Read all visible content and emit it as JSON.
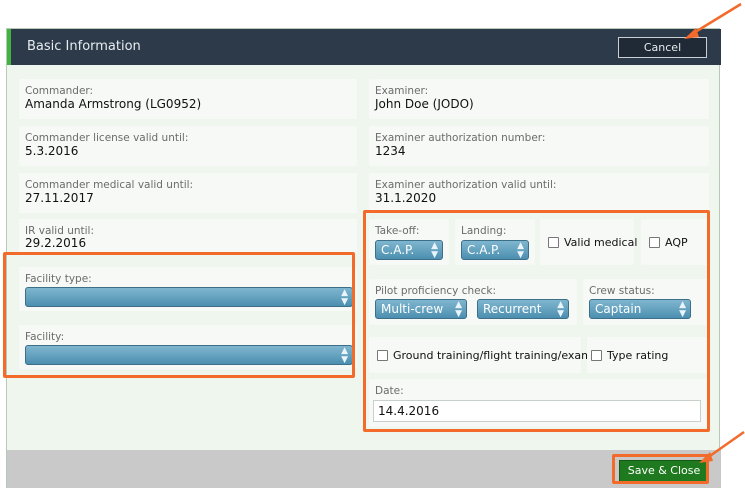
{
  "header": {
    "title": "Basic Information",
    "cancel_label": "Cancel"
  },
  "left": {
    "commander": {
      "label": "Commander:",
      "value": "Amanda Armstrong (LG0952)"
    },
    "license": {
      "label": "Commander license valid until:",
      "value": "5.3.2016"
    },
    "medical": {
      "label": "Commander medical valid until:",
      "value": "27.11.2017"
    },
    "ir": {
      "label": "IR valid until:",
      "value": "29.2.2016"
    },
    "facility_type": {
      "label": "Facility type:",
      "value": ""
    },
    "facility": {
      "label": "Facility:",
      "value": ""
    }
  },
  "right": {
    "examiner": {
      "label": "Examiner:",
      "value": "John Doe (JODO)"
    },
    "auth_number": {
      "label": "Examiner authorization number:",
      "value": "1234"
    },
    "auth_valid": {
      "label": "Examiner authorization valid until:",
      "value": "31.1.2020"
    },
    "takeoff": {
      "label": "Take-off:",
      "value": "C.A.P."
    },
    "landing": {
      "label": "Landing:",
      "value": "C.A.P."
    },
    "valid_medical": {
      "label": "Valid medical",
      "checked": false
    },
    "aqp": {
      "label": "AQP",
      "checked": false
    },
    "proficiency": {
      "label": "Pilot proficiency check:",
      "value1": "Multi-crew",
      "value2": "Recurrent"
    },
    "crew_status": {
      "label": "Crew status:",
      "value": "Captain"
    },
    "ground_training": {
      "label": "Ground training/flight training/exams",
      "checked": false
    },
    "type_rating": {
      "label": "Type rating",
      "checked": false
    },
    "date": {
      "label": "Date:",
      "value": "14.4.2016"
    }
  },
  "footer": {
    "save_label": "Save & Close"
  },
  "colors": {
    "header_bg": "#2c3a4a",
    "accent_green": "#3fb43f",
    "select_blue": "#5a9cbc",
    "save_green": "#1f7a1f",
    "highlight_orange": "#f26b2b"
  },
  "icons": {
    "select_arrows": "⬍"
  }
}
